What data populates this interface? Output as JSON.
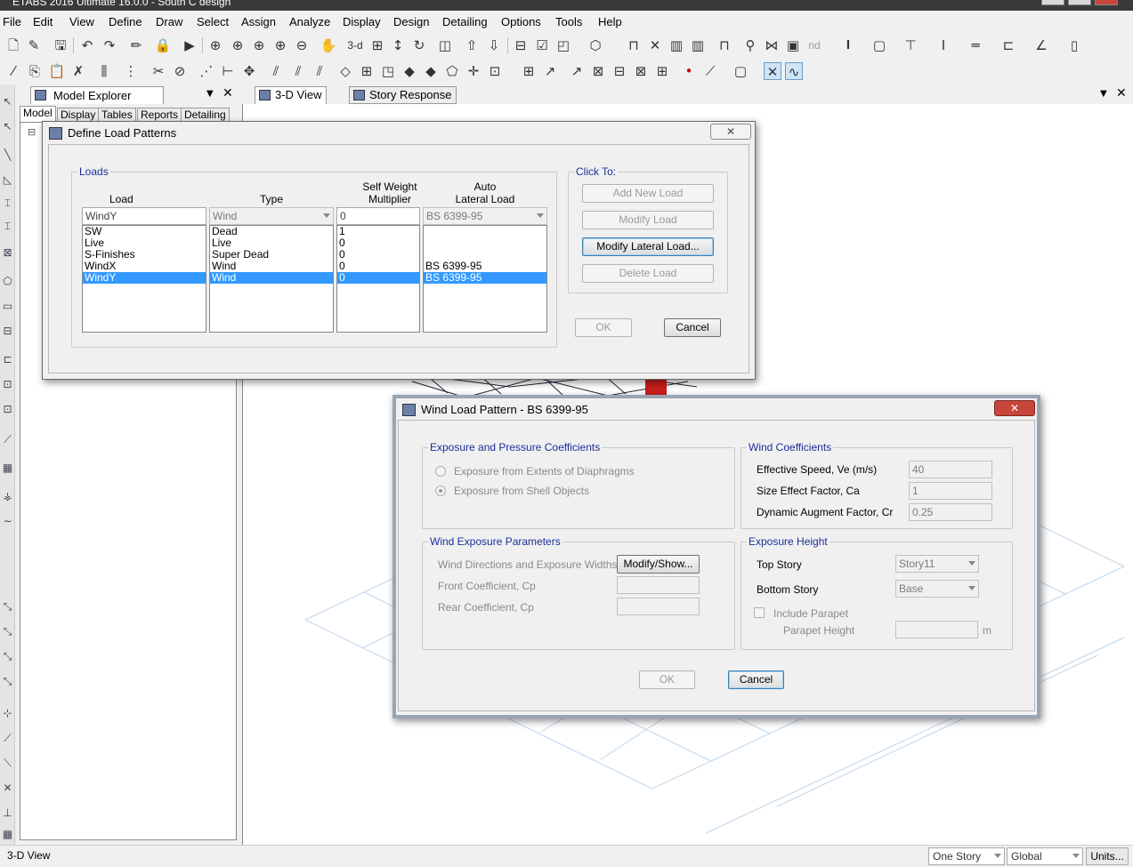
{
  "app": {
    "title": "ETABS 2016 Ultimate 16.0.0 - South C design"
  },
  "menu": [
    "File",
    "Edit",
    "View",
    "Define",
    "Draw",
    "Select",
    "Assign",
    "Analyze",
    "Display",
    "Design",
    "Detailing",
    "Options",
    "Tools",
    "Help"
  ],
  "toolbar_icons": {
    "row1": [
      "new-file-icon",
      "open-icon",
      "save-icon",
      "undo-icon",
      "redo-icon",
      "pencil-icon",
      "lock-icon",
      "run-icon",
      "zoom-window-icon",
      "zoom-rubber-icon",
      "zoom-in-icon",
      "zoom-out-icon",
      "pan-icon",
      "view-3d-icon",
      "plan-view-icon",
      "rotate-icon",
      "perspective-icon",
      "move-up-icon",
      "move-down-icon",
      "object-shrink-icon",
      "set-display-icon",
      "frame-icon",
      "section-icon",
      "beam-icon",
      "brace-icon",
      "wall-icon",
      "column-icon",
      "frame-draw-icon",
      "link-icon",
      "spring-icon",
      "render-icon"
    ],
    "row2": [
      "draw-icon",
      "copy-icon",
      "paste-icon",
      "delete-icon",
      "column-add-icon",
      "replicate-icon",
      "cut-icon",
      "rubber-icon",
      "align-icon",
      "move-icon",
      "select-icon",
      "point-icon",
      "shell-icon",
      "area-icon",
      "opening-icon",
      "snap-icon",
      "reshape-icon",
      "divide-icon",
      "merge-icon",
      "edge-icon",
      "deselect-icon",
      "frame-select-icon",
      "all-select-icon",
      "joint-load-icon",
      "frame-load-icon",
      "area-load-icon",
      "active-snap-icon"
    ],
    "labels": {
      "three_d": "3-d",
      "nd": "nd",
      "text_I": "I"
    }
  },
  "explorer": {
    "title": "Model Explorer",
    "tabs": [
      "Model",
      "Display",
      "Tables",
      "Reports",
      "Detailing"
    ],
    "tree_expander": "⊟"
  },
  "view_tabs": [
    "3-D View",
    "Story Response"
  ],
  "statusbar": {
    "left_text": "3-D View",
    "story_select": "One Story",
    "coord_select": "Global",
    "units_button": "Units..."
  },
  "define_load_patterns": {
    "title": "Define Load Patterns",
    "loads_group": "Loads",
    "col_load": "Load",
    "col_type": "Type",
    "col_self_weight": [
      "Self Weight",
      "Multiplier"
    ],
    "col_auto_lateral": [
      "Auto",
      "Lateral Load"
    ],
    "edit_row": {
      "load": "WindY",
      "type": "Wind",
      "multiplier": "0",
      "auto_lateral": "BS 6399-95"
    },
    "rows": [
      {
        "load": "SW",
        "type": "Dead",
        "multiplier": "1",
        "auto_lateral": ""
      },
      {
        "load": "Live",
        "type": "Live",
        "multiplier": "0",
        "auto_lateral": ""
      },
      {
        "load": "S-Finishes",
        "type": "Super Dead",
        "multiplier": "0",
        "auto_lateral": ""
      },
      {
        "load": "WindX",
        "type": "Wind",
        "multiplier": "0",
        "auto_lateral": "BS 6399-95"
      },
      {
        "load": "WindY",
        "type": "Wind",
        "multiplier": "0",
        "auto_lateral": "BS 6399-95"
      }
    ],
    "selected_row": 4,
    "click_to_group": "Click To:",
    "buttons": {
      "add_new_load": "Add New Load",
      "modify_load": "Modify Load",
      "modify_lateral_load": "Modify Lateral Load...",
      "delete_load": "Delete Load",
      "ok": "OK",
      "cancel": "Cancel"
    }
  },
  "wind_load_pattern": {
    "title": "Wind Load Pattern - BS 6399-95",
    "exposure_pressure_group": "Exposure and Pressure Coefficients",
    "radio_diaphragms": "Exposure from Extents of Diaphragms",
    "radio_shell": "Exposure from Shell Objects",
    "wind_coefficients_group": "Wind Coefficients",
    "effective_speed_label": "Effective Speed, Ve (m/s)",
    "effective_speed_value": "40",
    "size_effect_label": "Size Effect Factor, Ca",
    "size_effect_value": "1",
    "dynamic_augment_label": "Dynamic Augment Factor, Cr",
    "dynamic_augment_value": "0.25",
    "wind_exposure_group": "Wind Exposure Parameters",
    "wind_directions_label": "Wind Directions and Exposure Widths",
    "modify_show_button": "Modify/Show...",
    "front_coeff_label": "Front Coefficient, Cp",
    "front_coeff_value": "",
    "rear_coeff_label": "Rear Coefficient, Cp",
    "rear_coeff_value": "",
    "exposure_height_group": "Exposure Height",
    "top_story_label": "Top Story",
    "top_story_value": "Story11",
    "bottom_story_label": "Bottom Story",
    "bottom_story_value": "Base",
    "include_parapet_label": "Include Parapet",
    "parapet_height_label": "Parapet Height",
    "parapet_height_value": "",
    "parapet_unit": "m",
    "ok": "OK",
    "cancel": "Cancel"
  },
  "colors": {
    "selection": "#3399ff",
    "group_label": "#1a2f9a",
    "close_red": "#c7453a"
  }
}
